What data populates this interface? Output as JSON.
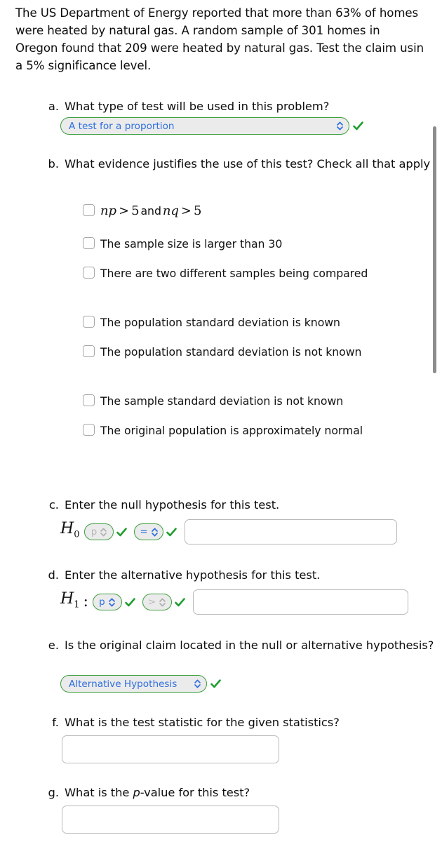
{
  "prompt": {
    "text": "The US Department of Energy reported that more than 63% of homes were heated by natural gas. A random sample of 301 homes in Oregon found that 209 were heated by natural gas. Test the claim usin a 5% significance level."
  },
  "questions": {
    "a": {
      "label": "a.",
      "text": "What type of test will be used in this problem?",
      "select_value": "A test for a proportion",
      "status": "correct"
    },
    "b": {
      "label": "b.",
      "text": "What evidence justifies the use of this test? Check all that apply",
      "options": [
        {
          "text": "np > 5 and nq > 5",
          "math": true,
          "checked": false
        },
        {
          "text": "The sample size is larger than 30",
          "math": false,
          "checked": false
        },
        {
          "text": "There are two different samples being compared",
          "math": false,
          "checked": false
        },
        {
          "text": "The population standard deviation is known",
          "math": false,
          "checked": false
        },
        {
          "text": "The population standard deviation is not known",
          "math": false,
          "checked": false
        },
        {
          "text": "The sample standard deviation is not known",
          "math": false,
          "checked": false
        },
        {
          "text": "The original population is approximately normal",
          "math": false,
          "checked": false
        }
      ]
    },
    "c": {
      "label": "c.",
      "text": "Enter the null hypothesis for this test.",
      "hypothesis_symbol": "H",
      "hypothesis_subscript": "0",
      "separator": "",
      "param_select": "p",
      "param_state": "faded",
      "operator_select": "=",
      "operator_state": "active",
      "value_input": "",
      "status": "correct"
    },
    "d": {
      "label": "d.",
      "text": "Enter the alternative hypothesis for this test.",
      "hypothesis_symbol": "H",
      "hypothesis_subscript": "1",
      "separator": ":",
      "param_select": "p",
      "param_state": "active",
      "operator_select": ">",
      "operator_state": "faded",
      "value_input": "",
      "status": "correct"
    },
    "e": {
      "label": "e.",
      "text": "Is the original claim located in the null or alternative hypothesis?",
      "select_value": "Alternative Hypothesis",
      "status": "correct"
    },
    "f": {
      "label": "f.",
      "text": "What is the test statistic for the given statistics?",
      "value_input": ""
    },
    "g": {
      "label": "g.",
      "text_before": "What is the ",
      "text_italic": "p",
      "text_after": "-value for this test?",
      "value_input": ""
    }
  },
  "icons": {
    "dropdown": "chevron-updown-icon",
    "check": "green-check-icon",
    "checkbox": "checkbox-unchecked-icon"
  },
  "colors": {
    "select_border": "#3c9e3c",
    "select_bg": "#ebebeb",
    "select_text": "#2f6fe0",
    "check": "#1f9d2f",
    "input_border": "#b9b9b9",
    "text": "#111111",
    "scrollbar": "#8c8c8c"
  }
}
